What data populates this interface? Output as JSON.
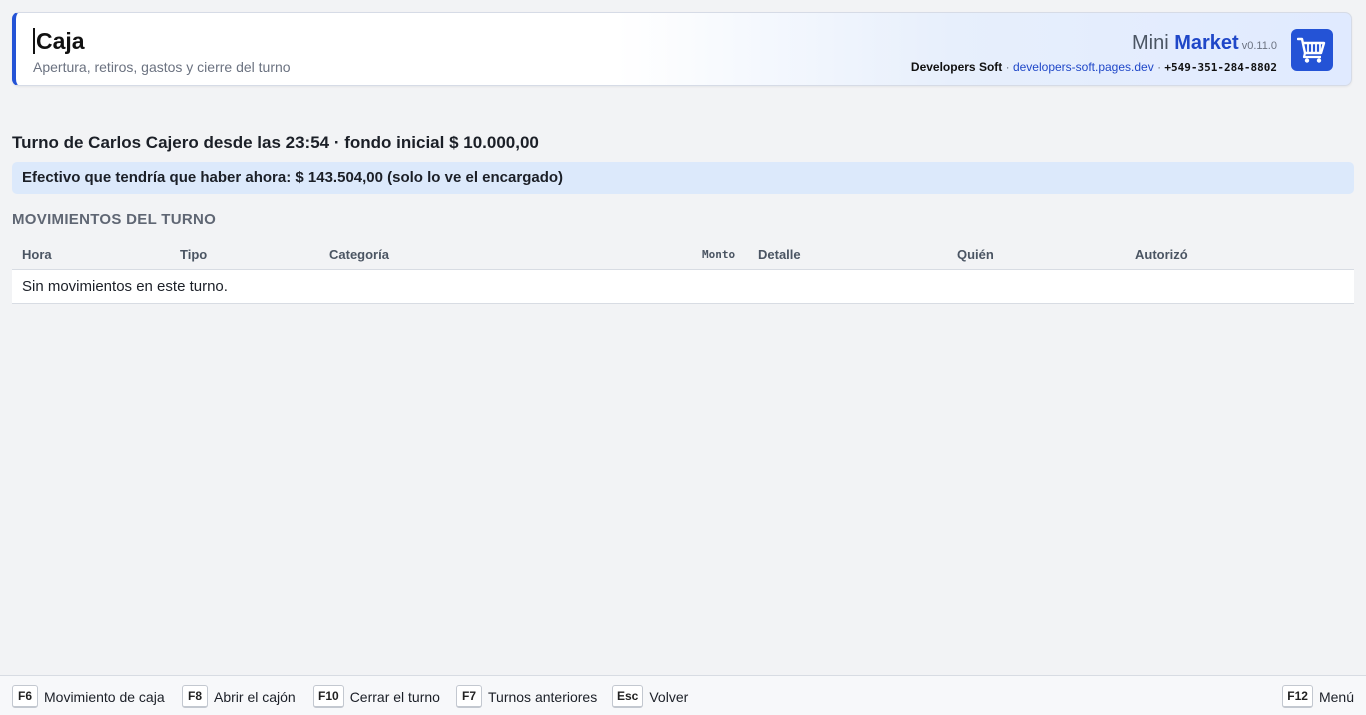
{
  "header": {
    "title": "Caja",
    "subtitle": "Apertura, retiros, gastos y cierre del turno",
    "brand_prefix": "Mini",
    "brand_name": "Market",
    "version": "v0.11.0",
    "company": "Developers Soft",
    "website": "developers-soft.pages.dev",
    "phone": "+549-351-284-8802",
    "separator": "·",
    "cart_icon": "shopping-cart-icon",
    "accent_color": "#2453d6"
  },
  "shift": {
    "info": "Turno de Carlos Cajero desde las 23:54 · fondo inicial $ 10.000,00",
    "expected_cash": "Efectivo que tendría que haber ahora: $ 143.504,00 (solo lo ve el encargado)"
  },
  "movements": {
    "title": "MOVIMIENTOS DEL TURNO",
    "columns": [
      "Hora",
      "Tipo",
      "Categoría",
      "Monto",
      "Detalle",
      "Quién",
      "Autorizó"
    ],
    "empty_message": "Sin movimientos en este turno."
  },
  "footer": {
    "shortcuts": [
      {
        "key": "F6",
        "label": "Movimiento de caja"
      },
      {
        "key": "F8",
        "label": "Abrir el cajón"
      },
      {
        "key": "F10",
        "label": "Cerrar el turno"
      },
      {
        "key": "F7",
        "label": "Turnos anteriores"
      },
      {
        "key": "Esc",
        "label": "Volver"
      }
    ],
    "menu": {
      "key": "F12",
      "label": "Menú"
    }
  }
}
